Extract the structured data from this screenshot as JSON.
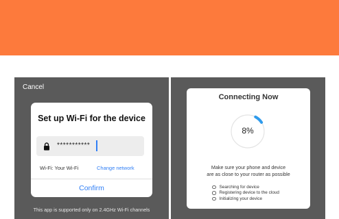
{
  "left_screen": {
    "cancel_label": "Cancel",
    "dialog": {
      "title": "Set up Wi-Fi for the device",
      "password_value": "***********",
      "wifi_label": "Wi-Fi: Your Wi-Fi",
      "change_network_label": "Change network",
      "confirm_label": "Confirm"
    },
    "support_note": "This app is supported only on 2.4GHz Wi-Fi channels"
  },
  "right_screen": {
    "title": "Connecting Now",
    "progress": {
      "percent": 8,
      "label": "8%"
    },
    "instructions": [
      "Make sure your phone and device",
      "are as close to your router as possible"
    ],
    "steps": [
      "Searching for device",
      "Registering device to the cloud",
      "Initializing your device"
    ]
  },
  "colors": {
    "banner": "#fd7a3c",
    "accent_blue": "#2f7ef5",
    "panel_gray": "#5a5a5a"
  },
  "icons": [
    "lock-icon",
    "progress-ring"
  ]
}
